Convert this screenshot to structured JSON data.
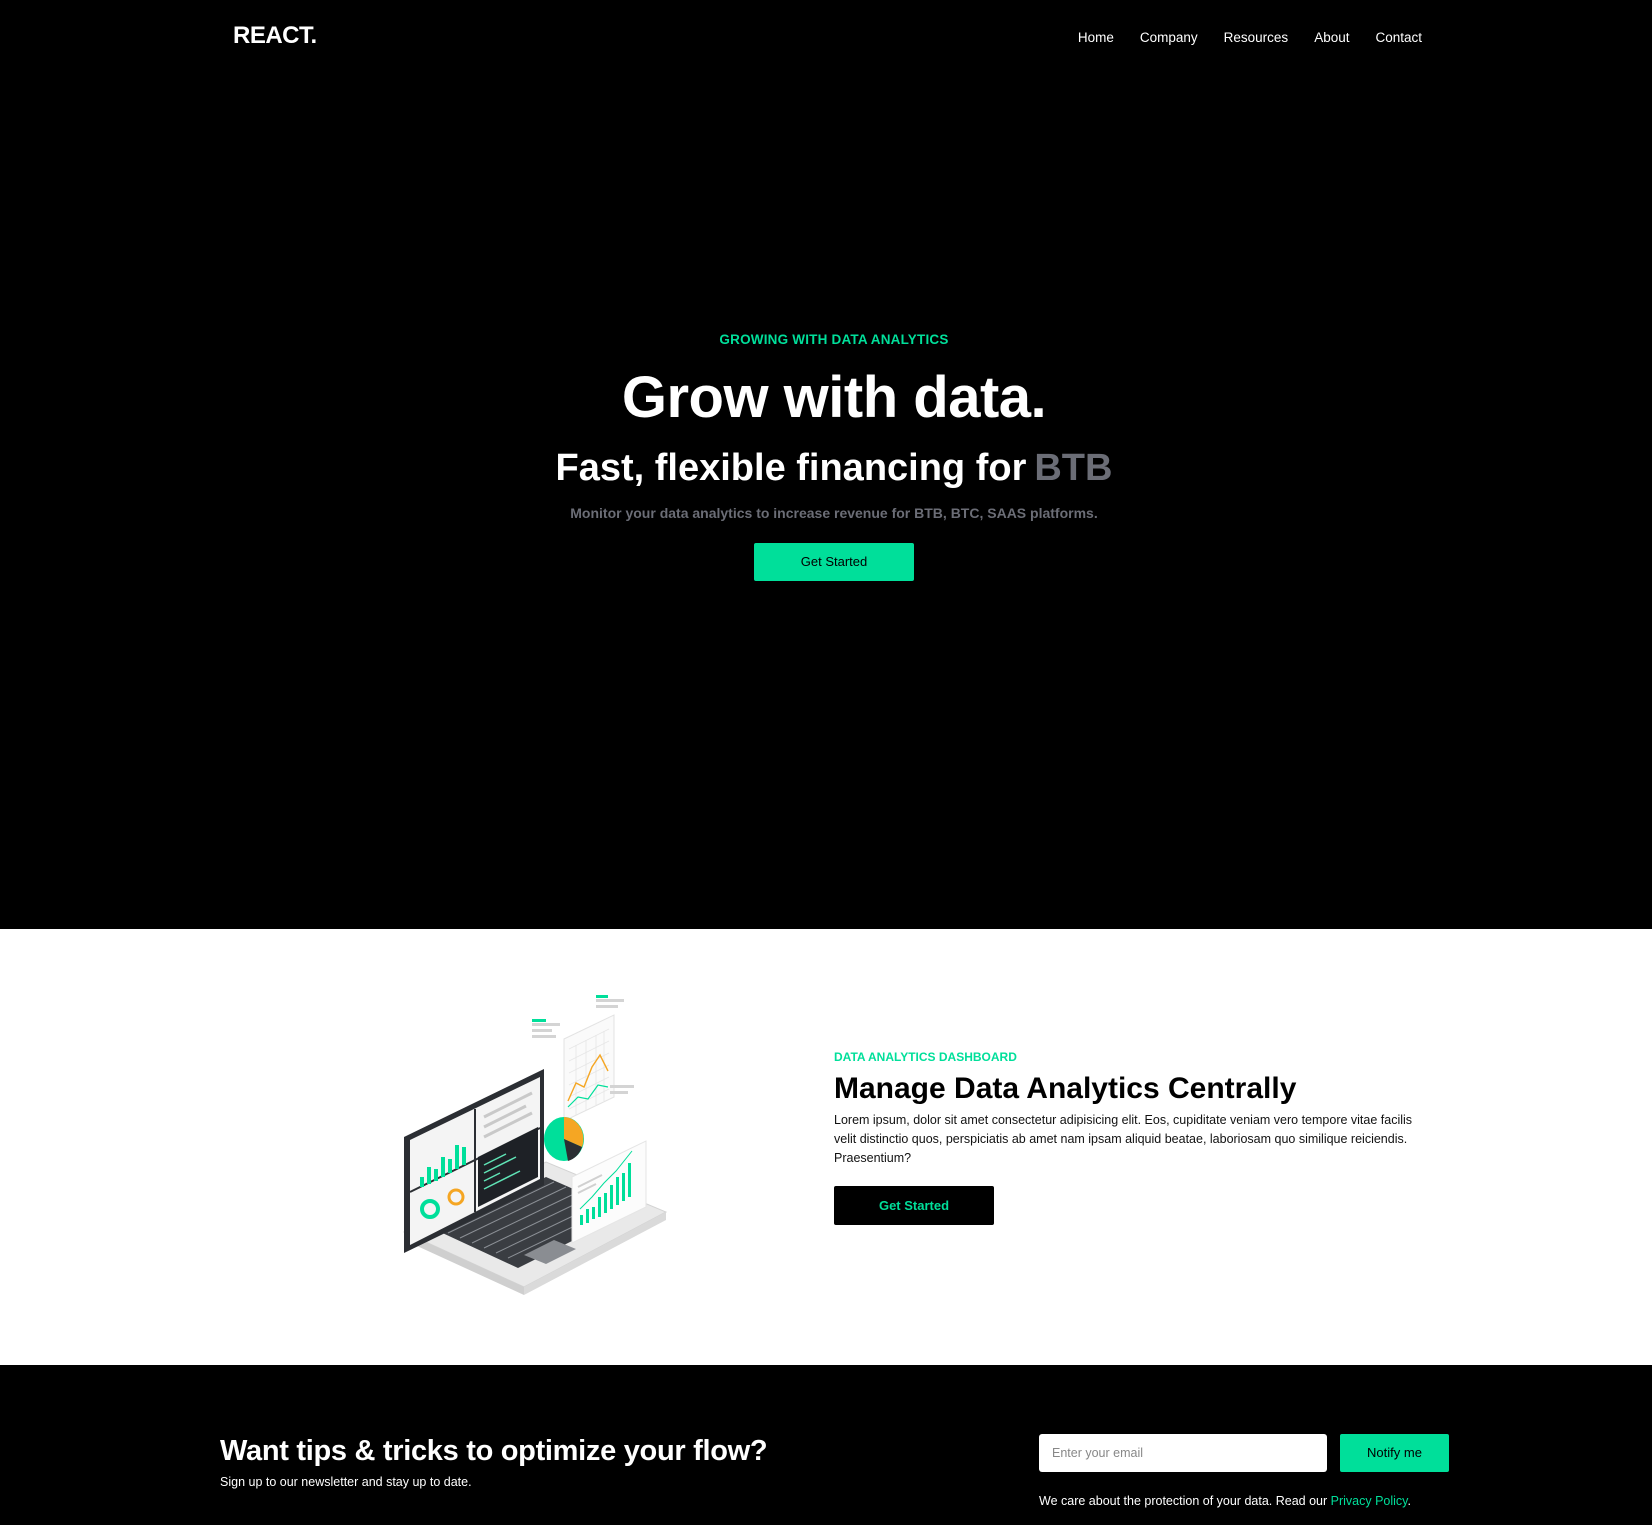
{
  "nav": {
    "logo": "REACT.",
    "links": [
      "Home",
      "Company",
      "Resources",
      "About",
      "Contact"
    ]
  },
  "hero": {
    "eyebrow": "GROWING WITH DATA ANALYTICS",
    "title": "Grow with data.",
    "subtitle_prefix": "Fast, flexible financing for",
    "subtitle_accent": "BTB",
    "description": "Monitor your data analytics to increase revenue for BTB, BTC, SAAS platforms.",
    "cta": "Get Started"
  },
  "analytics": {
    "eyebrow": "DATA ANALYTICS DASHBOARD",
    "title": "Manage Data Analytics Centrally",
    "body": "Lorem ipsum, dolor sit amet consectetur adipisicing elit. Eos, cupiditate veniam vero tempore vitae facilis velit distinctio quos, perspiciatis ab amet nam ipsam aliquid beatae, laboriosam quo similique reiciendis. Praesentium?",
    "cta": "Get Started"
  },
  "newsletter": {
    "title": "Want tips & tricks to optimize your flow?",
    "subtitle": "Sign up to our newsletter and stay up to date.",
    "email_placeholder": "Enter your email",
    "button": "Notify me",
    "privacy_text": "We care about the protection of your data. Read our",
    "privacy_link": "Privacy Policy",
    "privacy_end": "."
  },
  "colors": {
    "accent": "#00df9a",
    "muted": "#6b6d76",
    "background": "#000000"
  }
}
